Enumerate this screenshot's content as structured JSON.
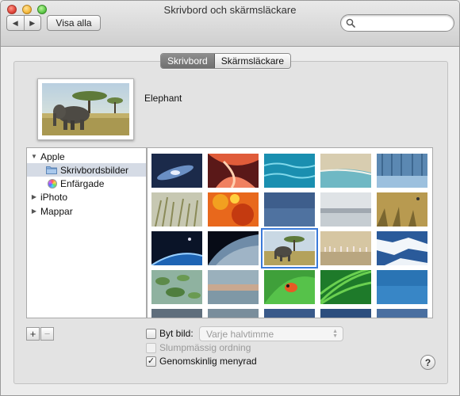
{
  "window": {
    "title": "Skrivbord och skärmsläckare"
  },
  "toolbar": {
    "back_icon": "◀",
    "forward_icon": "▶",
    "show_all_label": "Visa alla",
    "search_value": ""
  },
  "tabs": [
    {
      "label": "Skrivbord",
      "active": true
    },
    {
      "label": "Skärmsläckare",
      "active": false
    }
  ],
  "current_wallpaper": {
    "name": "Elephant"
  },
  "source_list": {
    "items": [
      {
        "label": "Apple",
        "expanded": true,
        "indent": 0
      },
      {
        "label": "Skrivbordsbilder",
        "selected": true,
        "indent": 1,
        "icon": "folder-icon"
      },
      {
        "label": "Enfärgade",
        "indent": 1,
        "icon": "color-wheel-icon"
      },
      {
        "label": "iPhoto",
        "expanded": false,
        "indent": 0
      },
      {
        "label": "Mappar",
        "expanded": false,
        "indent": 0
      }
    ]
  },
  "grid": {
    "thumbnails": [
      "galaxy",
      "red-canyon",
      "turquoise-water",
      "beach",
      "blue-forest",
      "grass",
      "autumn-leaves",
      "blue-texture",
      "fog-lake",
      "golden-grass",
      "earth-horizon",
      "earth-from-space",
      "elephant",
      "flamingos",
      "ice-floe",
      "lily-pads",
      "blurred-landscape",
      "frog-on-leaf",
      "green-blades",
      "blue-water"
    ],
    "selected_index": 12
  },
  "controls": {
    "plus_label": "+",
    "minus_label": "−",
    "change_picture_label": "Byt bild:",
    "change_picture_checked": false,
    "interval_value": "Varje halvtimme",
    "random_order_label": "Slumpmässig ordning",
    "random_order_checked": false,
    "translucent_menu_label": "Genomskinlig menyrad",
    "translucent_menu_checked": true,
    "checkmark": "✓",
    "help_label": "?"
  }
}
